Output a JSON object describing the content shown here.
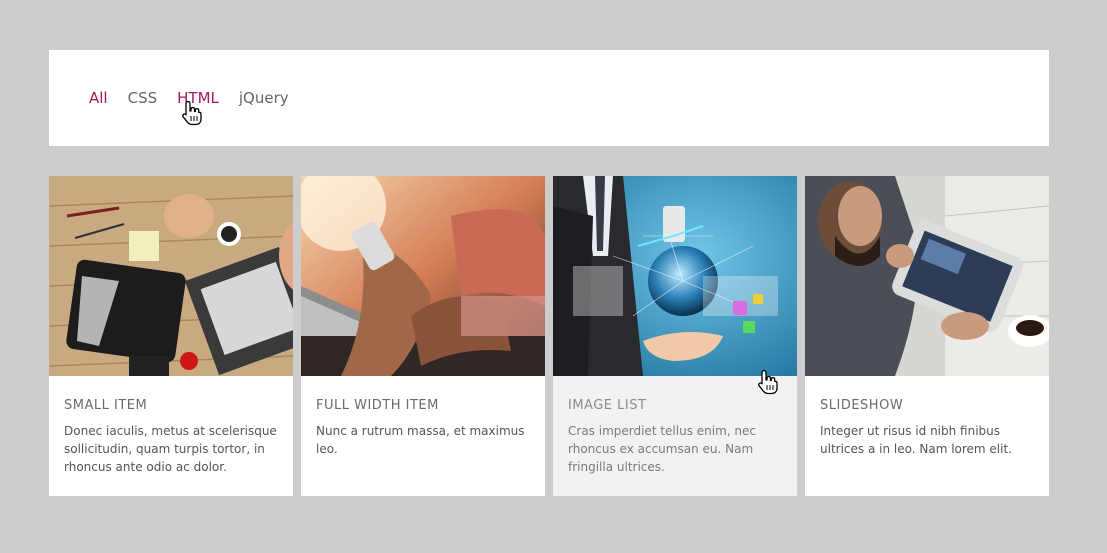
{
  "filters": [
    {
      "label": "All",
      "state": "active"
    },
    {
      "label": "CSS",
      "state": "normal"
    },
    {
      "label": "HTML",
      "state": "hover"
    },
    {
      "label": "jQuery",
      "state": "normal"
    }
  ],
  "cards": [
    {
      "image": "desk-with-tablet-laptop-image",
      "title": "SMALL ITEM",
      "description": "Donec iaculis, metus at scelerisque sollicitudin, quam turpis tortor, in rhoncus ante odio ac dolor."
    },
    {
      "image": "person-with-phone-laptop-image",
      "title": "FULL WIDTH ITEM",
      "description": "Nunc a rutrum massa, et maximus leo."
    },
    {
      "image": "businessman-holographic-globe-image",
      "title": "IMAGE LIST",
      "description": "Cras imperdiet tellus enim, nec rhoncus ex accumsan eu. Nam fringilla ultrices."
    },
    {
      "image": "man-with-tablet-image",
      "title": "SLIDESHOW",
      "description": "Integer ut risus id nibh finibus ultrices a in leo. Nam lorem elit."
    }
  ],
  "colors": {
    "background": "#cdcdcd",
    "accent": "#a01a5c",
    "text": "#666666"
  }
}
